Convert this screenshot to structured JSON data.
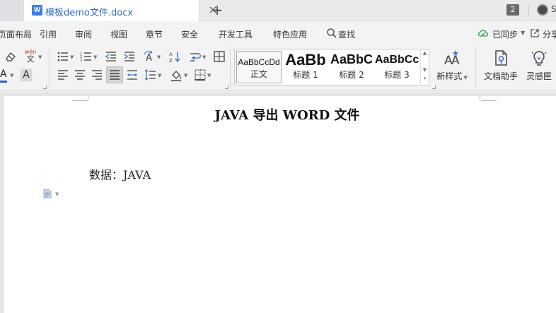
{
  "tabbar": {
    "doc_icon_letter": "W",
    "tab_title": "模板demo文件.docx",
    "close_glyph": "×",
    "new_tab_glyph": "+",
    "tab_count": "2",
    "user_initial": "S"
  },
  "menu": {
    "items": [
      "页面布局",
      "引用",
      "审阅",
      "视图",
      "章节",
      "安全",
      "开发工具",
      "特色应用",
      "查找"
    ],
    "sync_label": "已同步",
    "share_label": "分享"
  },
  "ribbon": {
    "phonetic_label": "wén",
    "styles": [
      {
        "sample": "AaBbCcDd",
        "name": "正文"
      },
      {
        "sample": "AaBb",
        "name": "标题 1"
      },
      {
        "sample": "AaBbC",
        "name": "标题 2"
      },
      {
        "sample": "AaBbCc",
        "name": "标题 3"
      }
    ],
    "new_style_label": "新样式",
    "doc_assistant_label": "文档助手",
    "inspiration_label": "灵感匣"
  },
  "document": {
    "title": "JAVA 导出 WORD 文件",
    "body": "数据：JAVA"
  },
  "colors": {
    "accent": "#2f6bd6",
    "font_color_bar": "#2f5fd0",
    "page_bg": "#ffffff",
    "canvas_bg": "#e6e6e6"
  }
}
